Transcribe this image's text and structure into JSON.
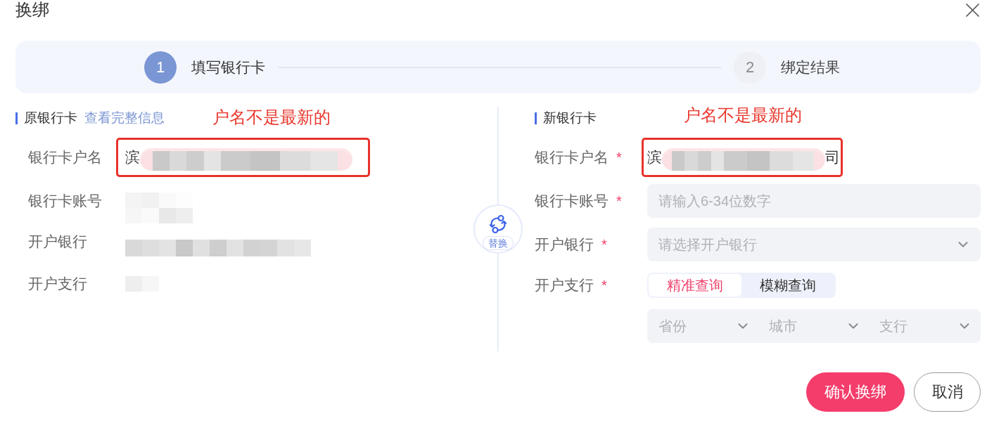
{
  "dialog": {
    "title": "换绑"
  },
  "steps": [
    {
      "number": "1",
      "label": "填写银行卡",
      "selected": true
    },
    {
      "number": "2",
      "label": "绑定结果",
      "selected": false
    }
  ],
  "original_card": {
    "heading": "原银行卡",
    "link": "查看完整信息",
    "annotation": "户名不是最新的",
    "rows": [
      {
        "label": "银行卡户名",
        "value_start": "滨",
        "annotated": true
      },
      {
        "label": "银行卡账号",
        "annotated": false
      },
      {
        "label": "开户银行",
        "annotated": false
      },
      {
        "label": "开户支行",
        "annotated": false
      }
    ]
  },
  "swap": {
    "label": "替换"
  },
  "new_card": {
    "heading": "新银行卡",
    "annotation": "户名不是最新的",
    "fields": [
      {
        "kind": "value",
        "label": "银行卡户名",
        "mark": "*",
        "value_start": "滨",
        "value_end": "司",
        "annotated": true
      },
      {
        "kind": "input",
        "label": "银行卡账号",
        "mark": "*",
        "placeholder": "请输入6-34位数字"
      },
      {
        "kind": "select",
        "label": "开户银行",
        "mark": "*",
        "placeholder": "请选择开户银行"
      },
      {
        "kind": "segmented",
        "label": "开户支行",
        "mark": "*",
        "options": [
          {
            "label": "精准查询",
            "selected": true
          },
          {
            "label": "模糊查询",
            "selected": false
          }
        ]
      },
      {
        "kind": "selects",
        "selects": [
          {
            "placeholder": "省份"
          },
          {
            "placeholder": "城市"
          },
          {
            "placeholder": "支行"
          }
        ]
      }
    ]
  },
  "buttons": [
    {
      "label": "确认换绑",
      "kind": "primary"
    },
    {
      "label": "取消",
      "kind": "secondary"
    }
  ]
}
